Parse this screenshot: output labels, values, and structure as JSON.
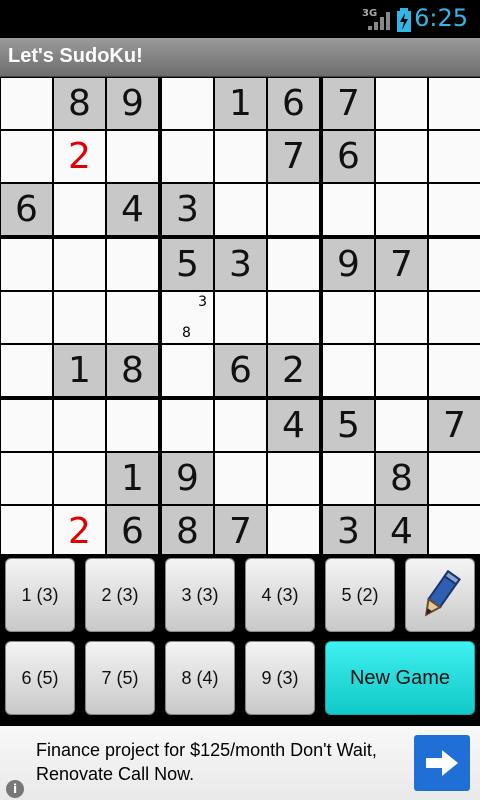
{
  "status_bar": {
    "network": "3G",
    "time": "6:25"
  },
  "app": {
    "title": "Let's SudoKu!"
  },
  "board": {
    "rows": [
      [
        "",
        "8",
        "9",
        "",
        "1",
        "6",
        "7",
        "",
        ""
      ],
      [
        "",
        "2",
        "",
        "",
        "",
        "7",
        "6",
        "",
        ""
      ],
      [
        "6",
        "",
        "4",
        "3",
        "",
        "",
        "",
        "",
        ""
      ],
      [
        "",
        "",
        "",
        "5",
        "3",
        "",
        "9",
        "7",
        ""
      ],
      [
        "",
        "",
        "",
        "",
        "",
        "",
        "",
        "",
        ""
      ],
      [
        "",
        "1",
        "8",
        "",
        "6",
        "2",
        "",
        "",
        ""
      ],
      [
        "",
        "",
        "",
        "",
        "",
        "4",
        "5",
        "",
        "7"
      ],
      [
        "",
        "",
        "1",
        "9",
        "",
        "",
        "",
        "8",
        ""
      ],
      [
        "",
        "2",
        "6",
        "8",
        "7",
        "",
        "3",
        "4",
        ""
      ]
    ],
    "user_cells": [
      [
        1,
        1
      ],
      [
        8,
        1
      ]
    ],
    "notes": [
      {
        "row": 4,
        "col": 3,
        "text": "3",
        "pos": "top-right"
      },
      {
        "row": 4,
        "col": 3,
        "text": "8",
        "pos": "bottom-center"
      }
    ],
    "colors": {
      "fixed": "#c8c8c8",
      "empty": "#fafafa",
      "user_digit": "#e00000"
    }
  },
  "keypad": {
    "keys": [
      "1 (3)",
      "2 (3)",
      "3 (3)",
      "4 (3)",
      "5 (2)",
      "6 (5)",
      "7 (5)",
      "8 (4)",
      "9 (3)"
    ],
    "pencil_icon": "pencil-icon",
    "new_game_label": "New Game",
    "new_game_color": "#20e0e0"
  },
  "ad": {
    "line1": "Finance project for $125/month Don't Wait,",
    "line2": "Renovate Call Now.",
    "arrow_icon": "arrow-right-icon",
    "info_icon": "info-icon"
  }
}
